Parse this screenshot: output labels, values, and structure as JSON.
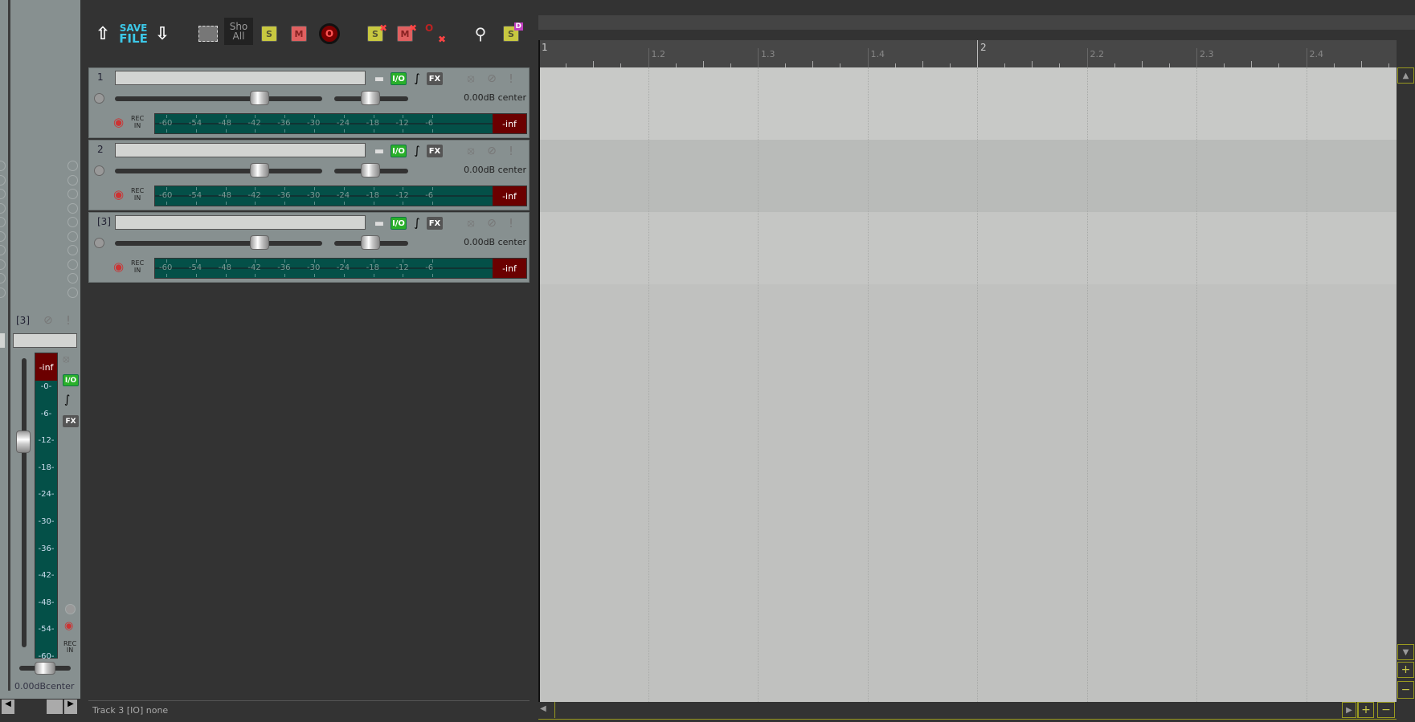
{
  "toolbar": {
    "save_file_label": [
      "SAVE",
      "FILE"
    ],
    "show_all_label": [
      "Sho",
      "All"
    ],
    "solo_label": "S",
    "mute_label": "M",
    "record_label": "O",
    "clear_solo_label": "S",
    "clear_mute_label": "M",
    "clear_rec_label": "O",
    "solo_defeat_label": "S",
    "solo_defeat_badge": "D",
    "icons": [
      "open-project-icon",
      "save-file-icon",
      "download-icon",
      "select-region-icon",
      "show-all-icon",
      "solo-icon",
      "mute-icon",
      "record-arm-icon",
      "clear-solo-icon",
      "clear-mute-icon",
      "clear-rec-icon",
      "routing-icon",
      "solo-defeat-icon"
    ]
  },
  "tracks": [
    {
      "number": "1",
      "name": "",
      "volume_pan": "0.00dB center",
      "io_label": "I/O",
      "fx_label": "FX",
      "rec_in": [
        "REC",
        "IN"
      ],
      "meter_peak": "-inf"
    },
    {
      "number": "2",
      "name": "",
      "volume_pan": "0.00dB center",
      "io_label": "I/O",
      "fx_label": "FX",
      "rec_in": [
        "REC",
        "IN"
      ],
      "meter_peak": "-inf"
    },
    {
      "number": "[3]",
      "name": "",
      "volume_pan": "0.00dB center",
      "io_label": "I/O",
      "fx_label": "FX",
      "rec_in": [
        "REC",
        "IN"
      ],
      "meter_peak": "-inf"
    }
  ],
  "meter_scale": [
    "-60",
    "-54",
    "-48",
    "-42",
    "-36",
    "-30",
    "-24",
    "-18",
    "-12",
    "-6"
  ],
  "mixer": {
    "track_number": "[3]",
    "meter_peak": "-inf",
    "io_label": "I/O",
    "fx_label": "FX",
    "scale": [
      "-0-",
      "-6-",
      "-12-",
      "-18-",
      "-24-",
      "-30-",
      "-36-",
      "-42-",
      "-48-",
      "-54-",
      "-60-"
    ],
    "rec_in": [
      "REC",
      "IN"
    ],
    "volume_pan": "0.00dBcenter"
  },
  "ruler": {
    "labels": [
      "1",
      "1.2",
      "1.3",
      "1.4",
      "2",
      "2.2",
      "2.3",
      "2.4"
    ]
  },
  "status": {
    "text": "Track 3 [IO] none"
  },
  "colors": {
    "track_panel": "#879090",
    "meter": "#045048",
    "meter_clip": "#6b0000",
    "io_green": "#2ab02a",
    "scroll_accent": "#9a9a20"
  }
}
